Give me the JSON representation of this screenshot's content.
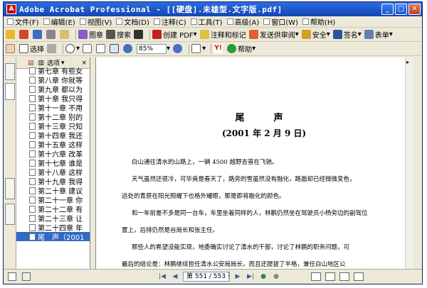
{
  "window": {
    "title": "Adobe Acrobat Professional - [[硬盘].未雄型.文字版.pdf]"
  },
  "menu": [
    {
      "label": "文件(F)"
    },
    {
      "label": "编辑(E)"
    },
    {
      "label": "视图(V)"
    },
    {
      "label": "文档(D)"
    },
    {
      "label": "注释(C)"
    },
    {
      "label": "工具(T)"
    },
    {
      "label": "高级(A)"
    },
    {
      "label": "窗口(W)"
    },
    {
      "label": "帮助(H)"
    }
  ],
  "toolbar1": {
    "btn_image": "图章",
    "btn_search": "搜索",
    "btn_create_pdf": "创建 PDF",
    "btn_comment": "注释和标记",
    "btn_send_review": "发送供审阅",
    "btn_secure": "安全",
    "btn_sign": "签名",
    "btn_forms": "表单"
  },
  "toolbar2": {
    "btn_select": "选择",
    "zoom_value": "85%",
    "btn_help": "帮助"
  },
  "bookmarks": {
    "header_label": "选项",
    "items": [
      {
        "label": "第七章 有些女"
      },
      {
        "label": "第八章 你就等"
      },
      {
        "label": "第九章 都以为"
      },
      {
        "label": "第十章 我只得"
      },
      {
        "label": "第十一章 不用"
      },
      {
        "label": "第十二章 别的"
      },
      {
        "label": "第十三章 只知"
      },
      {
        "label": "第十四章 我还"
      },
      {
        "label": "第十五章 这样"
      },
      {
        "label": "第十六章 改革"
      },
      {
        "label": "第十七章 谁是"
      },
      {
        "label": "第十八章 这样"
      },
      {
        "label": "第十九章 我得"
      },
      {
        "label": "第二十章 建议"
      },
      {
        "label": "第二十一章 你"
      },
      {
        "label": "第二十二章 有"
      },
      {
        "label": "第二十三章 让"
      },
      {
        "label": "第二十四章 年"
      },
      {
        "label": "尾　声（2001"
      }
    ]
  },
  "document": {
    "title": "尾　声",
    "date": "(2001 年 2 月 9 日)",
    "paragraphs": [
      "白山通往清水的山路上，一辆 4500 越野吉普在飞驰。",
      "天气虽然还很冷，可毕竟是春天了，路旁的雪虽然没有融化，路面却已经微微变色，",
      "远处的青原在阳光照耀下也格外耀眼，那是即将融化的颜色。",
      "和一年前差不多是同一台车，车里坐着同样的人，林鹏仍然坐在驾驶员小杨旁边的副驾位",
      "置上，后排仍然是谷局长和张主任。",
      "那些人的希望没能实现，地委确实讨论了清水的干部，讨论了林鹏的职务问题，可",
      "最后的结论是：林鹏继续担任清水公安局局长，而且还提拔了半格，兼任白山地区公"
    ]
  },
  "status": {
    "page_display": "第 551 / 553 页"
  }
}
